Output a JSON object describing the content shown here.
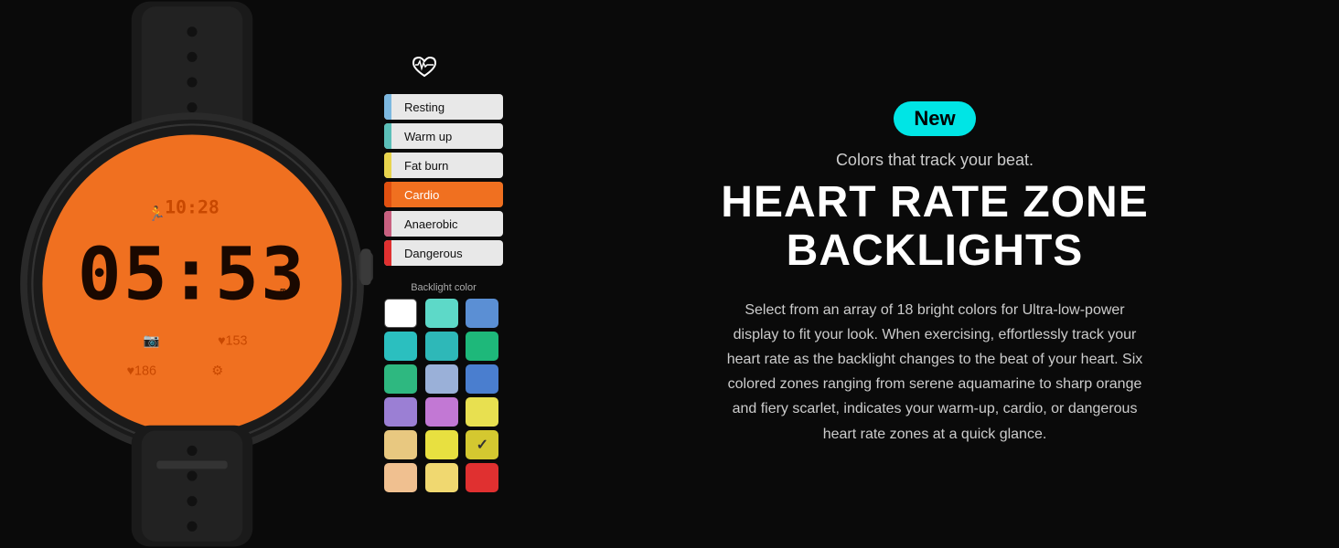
{
  "badge": {
    "label": "New"
  },
  "tagline": "Colors that track your beat.",
  "title_line1": "HEART RATE ZONE",
  "title_line2": "BACKLIGHTS",
  "description": "Select from an array of 18 bright colors for Ultra-low-power display to fit your look. When exercising, effortlessly track your heart rate as the backlight changes to the beat of your heart. Six colored zones ranging from serene aquamarine to sharp orange and fiery scarlet, indicates your warm-up, cardio, or dangerous heart rate zones at a quick glance.",
  "zones": [
    {
      "id": "resting",
      "label": "Resting",
      "bar_color": "#7cb8e0",
      "bg": "#e8e8e8",
      "active": false
    },
    {
      "id": "warmup",
      "label": "Warm up",
      "bar_color": "#5bbfb8",
      "bg": "#e8e8e8",
      "active": false
    },
    {
      "id": "fatburn",
      "label": "Fat burn",
      "bar_color": "#e8d44d",
      "bg": "#e8e8e8",
      "active": false
    },
    {
      "id": "cardio",
      "label": "Cardio",
      "bar_color": "#e05010",
      "bg": "#f07020",
      "active": true
    },
    {
      "id": "anaerobic",
      "label": "Anaerobic",
      "bar_color": "#c86080",
      "bg": "#e8e8e8",
      "active": false
    },
    {
      "id": "dangerous",
      "label": "Dangerous",
      "bar_color": "#e03030",
      "bg": "#e8e8e8",
      "active": false
    }
  ],
  "palette_label": "Backlight color",
  "colors": [
    "#ffffff",
    "#5dd9c8",
    "#5b8fd4",
    "#2bbfbf",
    "#2eb8b8",
    "#1eb87a",
    "#2eb880",
    "#9ab0d8",
    "#4a7ecf",
    "#9b7fd4",
    "#c278d4",
    "#e8e050",
    "#e8c880",
    "#e8e040",
    "#selected",
    "#f0c090",
    "#f0d870",
    "#e03030"
  ],
  "selected_color_index": 14,
  "watch": {
    "time": "05:53",
    "hour": "10:28",
    "steps": "186",
    "heartrate": "153",
    "bg_color": "#f07020"
  }
}
